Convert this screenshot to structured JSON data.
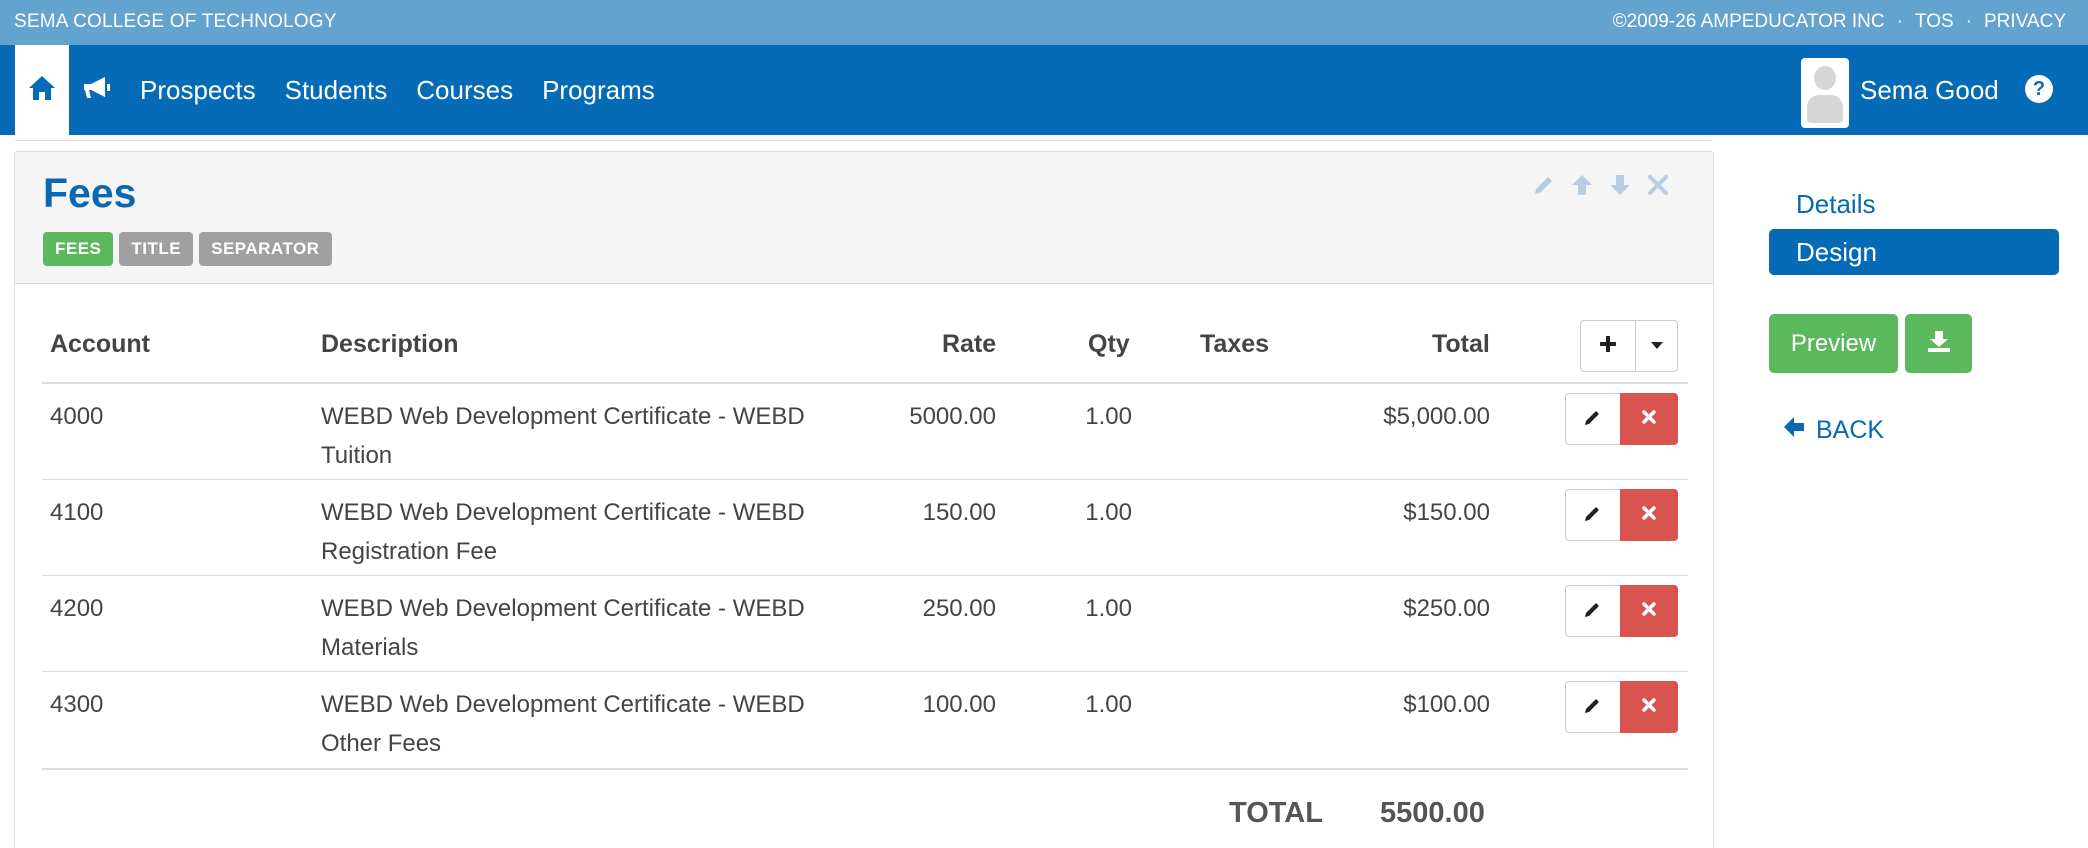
{
  "topbar": {
    "school": "SEMA COLLEGE OF TECHNOLOGY",
    "copyright": "©2009-26 AMPEDUCATOR INC",
    "tos": "TOS",
    "privacy": "PRIVACY",
    "separator": "·"
  },
  "nav": {
    "items": [
      {
        "label": "Prospects"
      },
      {
        "label": "Students"
      },
      {
        "label": "Courses"
      },
      {
        "label": "Programs"
      }
    ],
    "user_name": "Sema Good",
    "help_glyph": "?"
  },
  "panel": {
    "title": "Fees",
    "tags": [
      "FEES",
      "TITLE",
      "SEPARATOR"
    ]
  },
  "table": {
    "headers": {
      "account": "Account",
      "description": "Description",
      "rate": "Rate",
      "qty": "Qty",
      "taxes": "Taxes",
      "total": "Total"
    },
    "rows": [
      {
        "account": "4000",
        "desc1": "WEBD Web Development Certificate - WEBD",
        "desc2": "Tuition",
        "rate": "5000.00",
        "qty": "1.00",
        "taxes": "",
        "total": "$5,000.00"
      },
      {
        "account": "4100",
        "desc1": "WEBD Web Development Certificate - WEBD",
        "desc2": "Registration Fee",
        "rate": "150.00",
        "qty": "1.00",
        "taxes": "",
        "total": "$150.00"
      },
      {
        "account": "4200",
        "desc1": "WEBD Web Development Certificate - WEBD",
        "desc2": "Materials",
        "rate": "250.00",
        "qty": "1.00",
        "taxes": "",
        "total": "$250.00"
      },
      {
        "account": "4300",
        "desc1": "WEBD Web Development Certificate - WEBD",
        "desc2": "Other Fees",
        "rate": "100.00",
        "qty": "1.00",
        "taxes": "",
        "total": "$100.00"
      }
    ],
    "total_label": "TOTAL",
    "total_value": "5500.00"
  },
  "sidebar": {
    "details": "Details",
    "design": "Design",
    "preview": "Preview",
    "back": "BACK"
  },
  "colors": {
    "topbar": "#62a3d0",
    "navbar": "#066bb6",
    "accent": "#0868b1",
    "green": "#5cb85c",
    "danger": "#d9534f",
    "tag_gray": "#a0a0a0"
  }
}
